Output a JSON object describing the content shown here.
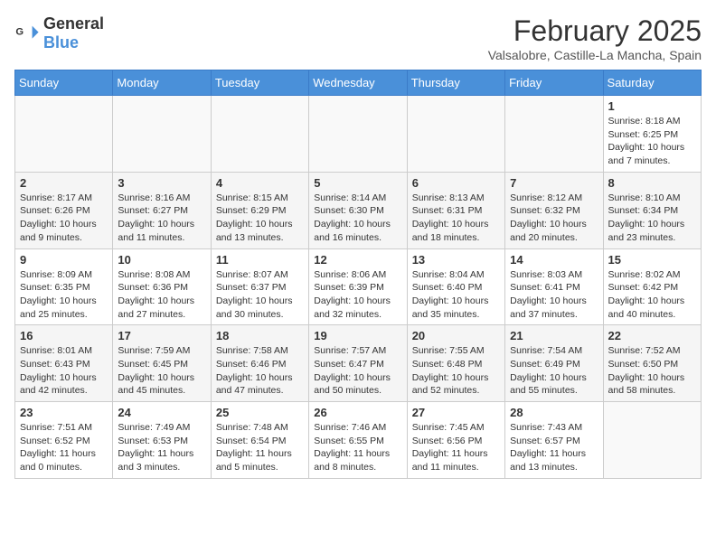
{
  "header": {
    "logo_general": "General",
    "logo_blue": "Blue",
    "month_year": "February 2025",
    "location": "Valsalobre, Castille-La Mancha, Spain"
  },
  "weekdays": [
    "Sunday",
    "Monday",
    "Tuesday",
    "Wednesday",
    "Thursday",
    "Friday",
    "Saturday"
  ],
  "weeks": [
    [
      {
        "day": "",
        "info": ""
      },
      {
        "day": "",
        "info": ""
      },
      {
        "day": "",
        "info": ""
      },
      {
        "day": "",
        "info": ""
      },
      {
        "day": "",
        "info": ""
      },
      {
        "day": "",
        "info": ""
      },
      {
        "day": "1",
        "info": "Sunrise: 8:18 AM\nSunset: 6:25 PM\nDaylight: 10 hours\nand 7 minutes."
      }
    ],
    [
      {
        "day": "2",
        "info": "Sunrise: 8:17 AM\nSunset: 6:26 PM\nDaylight: 10 hours\nand 9 minutes."
      },
      {
        "day": "3",
        "info": "Sunrise: 8:16 AM\nSunset: 6:27 PM\nDaylight: 10 hours\nand 11 minutes."
      },
      {
        "day": "4",
        "info": "Sunrise: 8:15 AM\nSunset: 6:29 PM\nDaylight: 10 hours\nand 13 minutes."
      },
      {
        "day": "5",
        "info": "Sunrise: 8:14 AM\nSunset: 6:30 PM\nDaylight: 10 hours\nand 16 minutes."
      },
      {
        "day": "6",
        "info": "Sunrise: 8:13 AM\nSunset: 6:31 PM\nDaylight: 10 hours\nand 18 minutes."
      },
      {
        "day": "7",
        "info": "Sunrise: 8:12 AM\nSunset: 6:32 PM\nDaylight: 10 hours\nand 20 minutes."
      },
      {
        "day": "8",
        "info": "Sunrise: 8:10 AM\nSunset: 6:34 PM\nDaylight: 10 hours\nand 23 minutes."
      }
    ],
    [
      {
        "day": "9",
        "info": "Sunrise: 8:09 AM\nSunset: 6:35 PM\nDaylight: 10 hours\nand 25 minutes."
      },
      {
        "day": "10",
        "info": "Sunrise: 8:08 AM\nSunset: 6:36 PM\nDaylight: 10 hours\nand 27 minutes."
      },
      {
        "day": "11",
        "info": "Sunrise: 8:07 AM\nSunset: 6:37 PM\nDaylight: 10 hours\nand 30 minutes."
      },
      {
        "day": "12",
        "info": "Sunrise: 8:06 AM\nSunset: 6:39 PM\nDaylight: 10 hours\nand 32 minutes."
      },
      {
        "day": "13",
        "info": "Sunrise: 8:04 AM\nSunset: 6:40 PM\nDaylight: 10 hours\nand 35 minutes."
      },
      {
        "day": "14",
        "info": "Sunrise: 8:03 AM\nSunset: 6:41 PM\nDaylight: 10 hours\nand 37 minutes."
      },
      {
        "day": "15",
        "info": "Sunrise: 8:02 AM\nSunset: 6:42 PM\nDaylight: 10 hours\nand 40 minutes."
      }
    ],
    [
      {
        "day": "16",
        "info": "Sunrise: 8:01 AM\nSunset: 6:43 PM\nDaylight: 10 hours\nand 42 minutes."
      },
      {
        "day": "17",
        "info": "Sunrise: 7:59 AM\nSunset: 6:45 PM\nDaylight: 10 hours\nand 45 minutes."
      },
      {
        "day": "18",
        "info": "Sunrise: 7:58 AM\nSunset: 6:46 PM\nDaylight: 10 hours\nand 47 minutes."
      },
      {
        "day": "19",
        "info": "Sunrise: 7:57 AM\nSunset: 6:47 PM\nDaylight: 10 hours\nand 50 minutes."
      },
      {
        "day": "20",
        "info": "Sunrise: 7:55 AM\nSunset: 6:48 PM\nDaylight: 10 hours\nand 52 minutes."
      },
      {
        "day": "21",
        "info": "Sunrise: 7:54 AM\nSunset: 6:49 PM\nDaylight: 10 hours\nand 55 minutes."
      },
      {
        "day": "22",
        "info": "Sunrise: 7:52 AM\nSunset: 6:50 PM\nDaylight: 10 hours\nand 58 minutes."
      }
    ],
    [
      {
        "day": "23",
        "info": "Sunrise: 7:51 AM\nSunset: 6:52 PM\nDaylight: 11 hours\nand 0 minutes."
      },
      {
        "day": "24",
        "info": "Sunrise: 7:49 AM\nSunset: 6:53 PM\nDaylight: 11 hours\nand 3 minutes."
      },
      {
        "day": "25",
        "info": "Sunrise: 7:48 AM\nSunset: 6:54 PM\nDaylight: 11 hours\nand 5 minutes."
      },
      {
        "day": "26",
        "info": "Sunrise: 7:46 AM\nSunset: 6:55 PM\nDaylight: 11 hours\nand 8 minutes."
      },
      {
        "day": "27",
        "info": "Sunrise: 7:45 AM\nSunset: 6:56 PM\nDaylight: 11 hours\nand 11 minutes."
      },
      {
        "day": "28",
        "info": "Sunrise: 7:43 AM\nSunset: 6:57 PM\nDaylight: 11 hours\nand 13 minutes."
      },
      {
        "day": "",
        "info": ""
      }
    ]
  ]
}
